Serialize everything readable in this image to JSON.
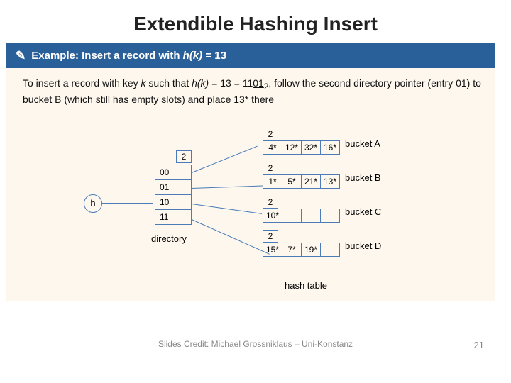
{
  "title": "Extendible Hashing Insert",
  "band": {
    "icon": "✎",
    "prefix": "Example: Insert a record with ",
    "hk": "h(k)",
    "rest": " = 13"
  },
  "body": {
    "t1": "To insert a record with key ",
    "k": "k",
    "t2": " such that ",
    "hk": "h(k)",
    "t3": " = 13 = 11",
    "underlined": "01",
    "sub": "2",
    "t4": ", follow the second directory pointer (entry 01) to bucket B (which still has empty slots) and place 13* there"
  },
  "diagram": {
    "h": "h",
    "global_depth": "2",
    "dir_entries": [
      "00",
      "01",
      "10",
      "11"
    ],
    "dir_label": "directory",
    "buckets": [
      {
        "ld": "2",
        "cells": [
          "4*",
          "12*",
          "32*",
          "16*"
        ],
        "label": "bucket A"
      },
      {
        "ld": "2",
        "cells": [
          "1*",
          "5*",
          "21*",
          "13*"
        ],
        "label": "bucket B"
      },
      {
        "ld": "2",
        "cells": [
          "10*",
          "",
          "",
          ""
        ],
        "label": "bucket C"
      },
      {
        "ld": "2",
        "cells": [
          "15*",
          "7*",
          "19*",
          ""
        ],
        "label": "bucket D"
      }
    ],
    "ht_label": "hash table"
  },
  "credit": "Slides Credit: Michael Grossniklaus – Uni-Konstanz",
  "pagenum": "21"
}
